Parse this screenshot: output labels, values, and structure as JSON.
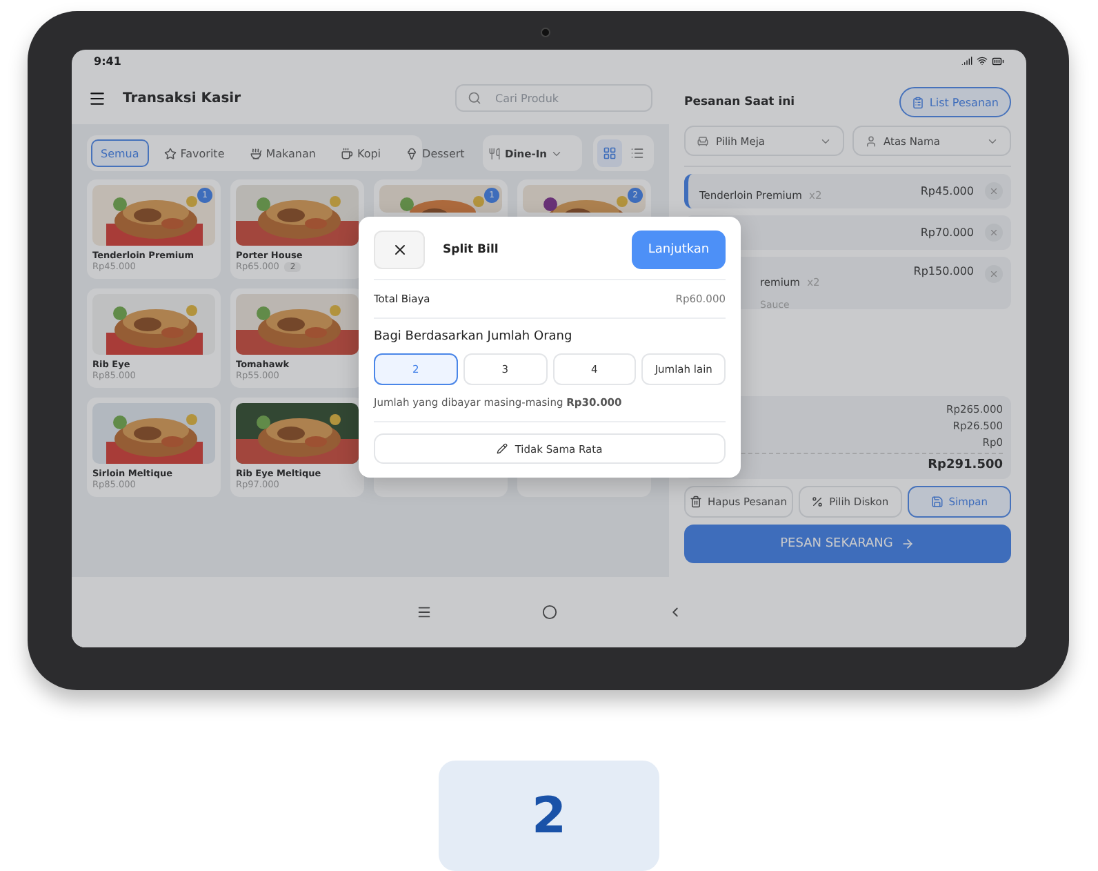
{
  "status_bar": {
    "time": "9:41"
  },
  "header": {
    "title": "Transaksi Kasir",
    "search_placeholder": "Cari Produk"
  },
  "categories": [
    {
      "label": "Semua",
      "selected": true,
      "kind": "none"
    },
    {
      "label": "Favorite",
      "selected": false,
      "kind": "star"
    },
    {
      "label": "Makanan",
      "selected": false,
      "kind": "food"
    },
    {
      "label": "Kopi",
      "selected": false,
      "kind": "cup"
    },
    {
      "label": "Dessert",
      "selected": false,
      "kind": "icecream"
    }
  ],
  "order_type": "Dine-In",
  "view_modes": [
    {
      "kind": "grid",
      "selected": true
    },
    {
      "kind": "list",
      "selected": false
    }
  ],
  "product_rows": [
    [
      {
        "kind": "picture",
        "name": "Tenderloin Premium",
        "price": "Rp45.000",
        "badge": "1"
      },
      {
        "kind": "picture",
        "name": "Porter House",
        "price": "Rp65.000",
        "qty": "2"
      },
      {
        "kind": "picture",
        "badge": "1"
      },
      {
        "kind": "picture",
        "badge": "2"
      }
    ],
    [
      {
        "kind": "picture",
        "name": "Rib Eye",
        "price": "Rp85.000"
      },
      {
        "kind": "picture",
        "name": "Tomahawk",
        "price": "Rp55.000"
      }
    ],
    [
      {
        "kind": "picture",
        "name": "Sirloin Meltique",
        "price": "Rp85.000"
      },
      {
        "kind": "picture",
        "name": "Rib Eye Meltique",
        "price": "Rp97.000"
      },
      {
        "kind": "plain"
      },
      {
        "kind": "plain"
      }
    ]
  ],
  "order": {
    "title": "Pesanan Saat ini",
    "list_button": "List Pesanan",
    "table_select": "Pilih Meja",
    "name_select": "Atas Nama",
    "items": [
      {
        "kind": "active",
        "name": "Tenderloin Premium",
        "qty": "x2",
        "price": "Rp45.000"
      },
      {
        "kind": "clipped",
        "price": "Rp70.000"
      },
      {
        "kind": "clipped",
        "name": "remium",
        "qty": "x2",
        "price": "Rp150.000",
        "note": "Sauce"
      }
    ],
    "totals": [
      "Rp265.000",
      "Rp26.500",
      "Rp0"
    ],
    "grand_total": "Rp291.500",
    "actions": [
      {
        "label": "Hapus Pesanan",
        "kind": "delete"
      },
      {
        "label": "Pilih Diskon",
        "kind": "discount"
      },
      {
        "label": "Simpan",
        "kind": "save"
      }
    ],
    "submit": "PESAN SEKARANG"
  },
  "modal": {
    "title": "Split Bill",
    "confirm": "Lanjutkan",
    "total_label": "Total Biaya",
    "total_value": "Rp60.000",
    "split_heading": "Bagi Berdasarkan Jumlah Orang",
    "options": [
      {
        "label": "2",
        "selected": true
      },
      {
        "label": "3",
        "selected": false
      },
      {
        "label": "4",
        "selected": false
      },
      {
        "label": "Jumlah lain",
        "selected": false
      }
    ],
    "per_person": "Jumlah yang dibayar masing-masing **Rp30.000**",
    "unequal_button": "Tidak Sama Rata"
  },
  "page_badge": "2"
}
